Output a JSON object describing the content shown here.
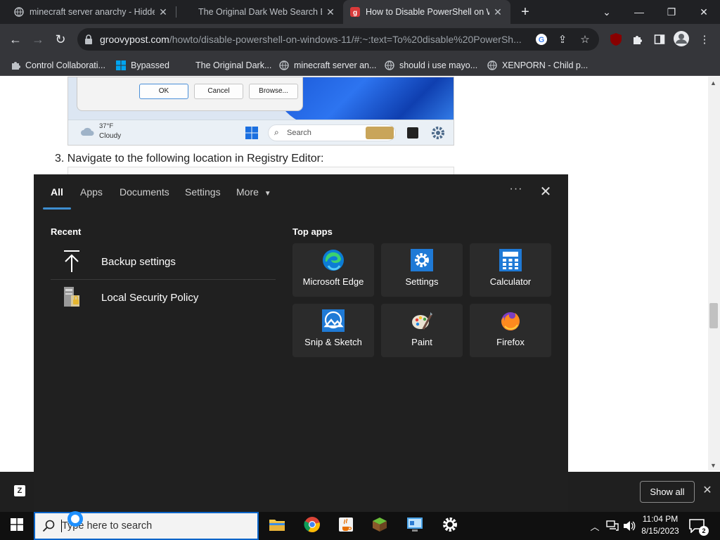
{
  "browser": {
    "tabs": [
      {
        "title": "minecraft server anarchy - Hidde",
        "active": false
      },
      {
        "title": "The Original Dark Web Search En",
        "active": false
      },
      {
        "title": "How to Disable PowerShell on W",
        "active": true
      }
    ],
    "new_tab_label": "+",
    "url_domain": "groovypost.com",
    "url_path": "/howto/disable-powershell-on-windows-11/#:~:text=To%20disable%20PowerSh...",
    "bookmarks": [
      {
        "label": "Control Collaborati...",
        "icon": "puzzle-icon"
      },
      {
        "label": "Bypassed",
        "icon": "windows-icon"
      },
      {
        "label": "The Original Dark...",
        "icon": "none"
      },
      {
        "label": "minecraft server an...",
        "icon": "globe-icon"
      },
      {
        "label": "should i use mayo...",
        "icon": "globe-icon"
      },
      {
        "label": "XENPORN - Child p...",
        "icon": "globe-icon"
      }
    ],
    "extension_badge": "7"
  },
  "article": {
    "dialog_buttons": [
      "OK",
      "Cancel",
      "Browse..."
    ],
    "weather_temp": "37°F",
    "weather_desc": "Cloudy",
    "mini_search_placeholder": "Search",
    "step_number": "3.",
    "step_text": "Navigate to the following location in Registry Editor:"
  },
  "search_panel": {
    "tabs": [
      "All",
      "Apps",
      "Documents",
      "Settings",
      "More"
    ],
    "selected_tab": "All",
    "more_menu_label": "···",
    "recent_title": "Recent",
    "recent_items": [
      {
        "label": "Backup settings",
        "icon": "upload-arrow-icon"
      },
      {
        "label": "Local Security Policy",
        "icon": "security-policy-icon"
      }
    ],
    "top_apps_title": "Top apps",
    "top_apps": [
      {
        "label": "Microsoft Edge",
        "icon": "edge-icon"
      },
      {
        "label": "Settings",
        "icon": "settings-icon"
      },
      {
        "label": "Calculator",
        "icon": "calculator-icon"
      },
      {
        "label": "Snip & Sketch",
        "icon": "snip-sketch-icon"
      },
      {
        "label": "Paint",
        "icon": "paint-icon"
      },
      {
        "label": "Firefox",
        "icon": "firefox-icon"
      }
    ]
  },
  "notification": {
    "show_all_label": "Show all"
  },
  "taskbar": {
    "search_placeholder": "Type here to search",
    "time": "11:04 PM",
    "date": "8/15/2023",
    "notification_count": "2"
  },
  "colors": {
    "accent": "#3e8ed0",
    "panel_bg": "#202020",
    "tile_bg": "#2b2b2b",
    "chrome_dark": "#202124"
  }
}
